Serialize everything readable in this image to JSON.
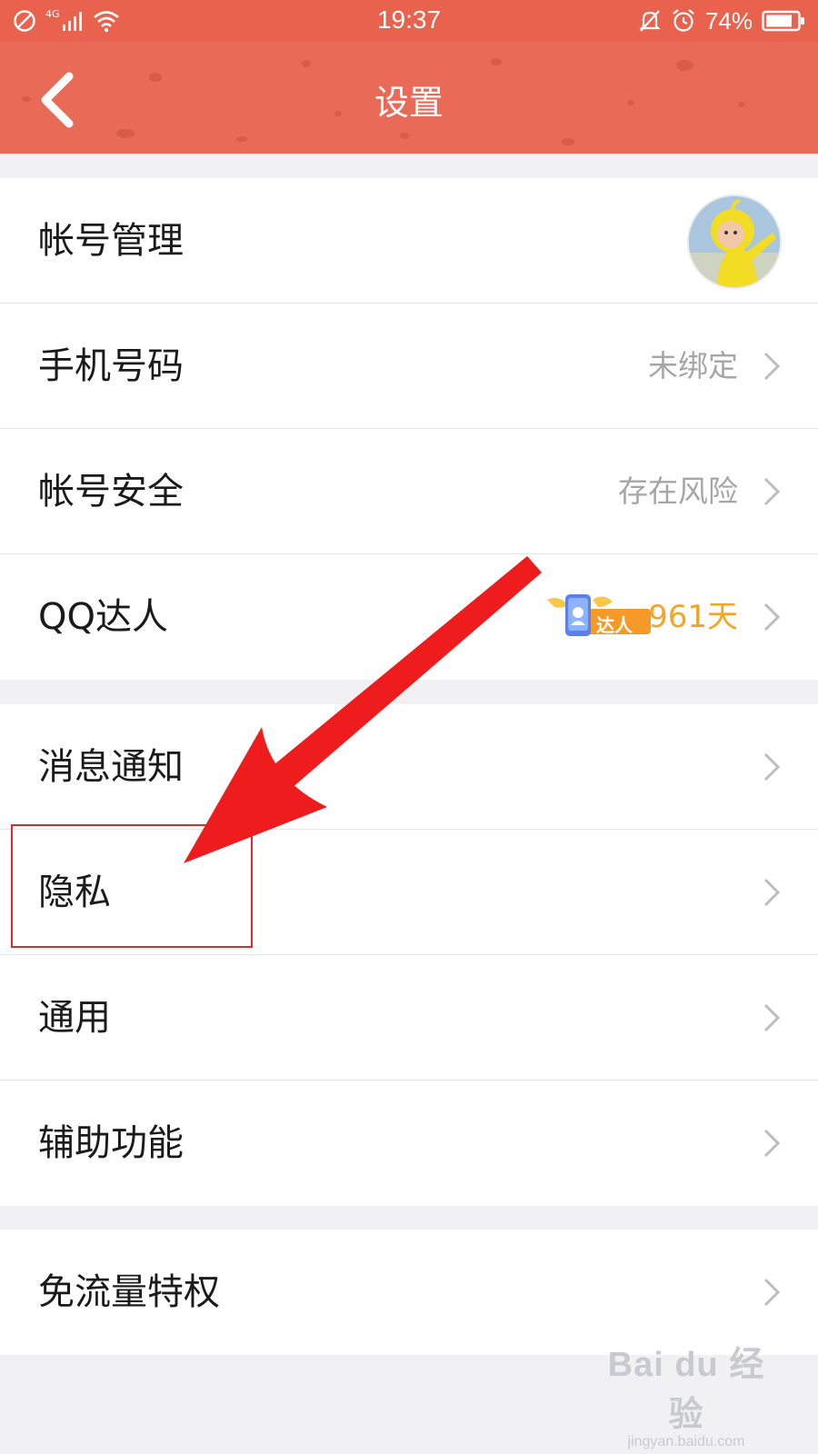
{
  "status_bar": {
    "time": "19:37",
    "battery": "74%",
    "network": "4G",
    "icons": [
      "no-disturb-icon",
      "signal-icon",
      "wifi-icon",
      "mute-bell-icon",
      "alarm-icon",
      "battery-icon"
    ]
  },
  "nav": {
    "title": "设置",
    "back_icon": "back-chevron-icon"
  },
  "group1": [
    {
      "label": "帐号管理"
    },
    {
      "label": "手机号码",
      "value": "未绑定"
    },
    {
      "label": "帐号安全",
      "value": "存在风险"
    },
    {
      "label": "QQ达人",
      "badge_text": "达人",
      "value": "961天"
    }
  ],
  "group2": [
    {
      "label": "消息通知"
    },
    {
      "label": "隐私"
    },
    {
      "label": "通用"
    },
    {
      "label": "辅助功能"
    }
  ],
  "group3": [
    {
      "label": "免流量特权"
    }
  ],
  "watermark": {
    "main": "Bai du 经验",
    "sub": "jingyan.baidu.com"
  },
  "colors": {
    "header": "#e96a56",
    "status_bar": "#e8624d",
    "annotation_red": "#e22a2a",
    "days_orange": "#f3a52a",
    "value_gray": "#a6a6a6"
  }
}
